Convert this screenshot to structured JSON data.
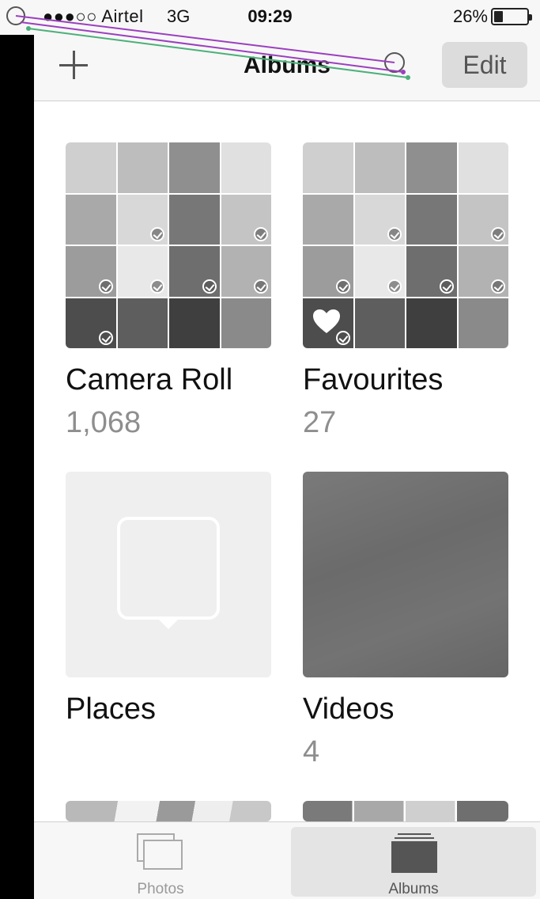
{
  "status_bar": {
    "carrier": "●●●○○ Airtel",
    "network": "3G",
    "time": "09:29",
    "battery_percent": "26%",
    "battery_level": 0.26
  },
  "nav": {
    "title": "Albums",
    "edit_label": "Edit",
    "add_icon": "plus-icon"
  },
  "albums": [
    {
      "name": "Camera Roll",
      "count": "1,068",
      "thumb": "photo-mosaic"
    },
    {
      "name": "Favourites",
      "count": "27",
      "thumb": "photo-mosaic-with-heart"
    },
    {
      "name": "Places",
      "count": "",
      "thumb": "places-placeholder"
    },
    {
      "name": "Videos",
      "count": "4",
      "thumb": "video-frame"
    }
  ],
  "tabs": [
    {
      "label": "Photos",
      "icon": "photos-stack-icon",
      "selected": false
    },
    {
      "label": "Albums",
      "icon": "albums-folder-icon",
      "selected": true
    }
  ],
  "colors": {
    "bar_bg": "#f7f7f7",
    "label_gray": "#8e8e8e",
    "overlay_purple": "#9b3fbf",
    "overlay_green": "#4caf7a"
  }
}
